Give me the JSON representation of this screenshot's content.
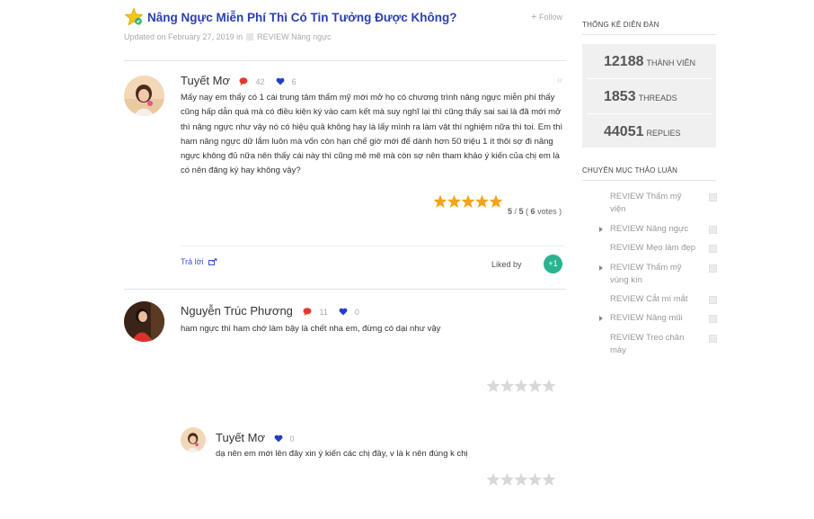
{
  "post": {
    "title": "Nâng Ngực Miễn Phí Thì Có Tin Tưởng Được Không?",
    "updated": "Updated on February 27, 2019 in",
    "category": "REVIEW Nâng ngực",
    "follow_label": "Follow"
  },
  "comments": [
    {
      "author": "Tuyết Mơ",
      "comment_count": "42",
      "like_count": "6",
      "text": "Mấy nay em thấy có 1 cái trung tâm thẩm mỹ mới mở họ có chương trình nâng ngực miễn phí thấy cũng hấp dẫn quá mà có điều kiện ký vào cam kết mà suy nghĩ lại thì cũng thấy sai sai là đã mới mở thì nâng ngực như vậy nó có hiệu quả không hay là lấy mình ra làm vật thí nghiệm nữa thì toi. Em thì ham nâng ngực dữ lắm luôn mà vốn còn hạn chế giờ mới để dành hơn 50 triệu 1 ít thôi sợ đi nâng ngực không đủ nữa nên thấy cái này thì cũng mê mê mà còn sợ nên tham khảo ý kiến của chị em là có nên đăng ký hay không vậy?",
      "rating_score": "5",
      "rating_max": "5",
      "rating_votes": "6",
      "rating_value": 5,
      "votes_word": "votes",
      "reply_label": "Trả lời",
      "liked_by_label": "Liked by",
      "plus_label": "+1"
    },
    {
      "author": "Nguyễn Trúc Phương",
      "comment_count": "11",
      "like_count": "0",
      "text": "ham ngực thì ham chớ làm bậy là chết nha em, đừng có dại như vậy",
      "rating_value": 0
    },
    {
      "author": "Tuyết Mơ",
      "like_count": "0",
      "text": "dạ nên em mới lên đây xin ý kiến các chị đây, v là k nên đúng k chị",
      "rating_value": 0
    }
  ],
  "sidebar": {
    "stats_heading": "THỐNG KÊ DIỄN ĐÀN",
    "stats": [
      {
        "value": "12188",
        "label": "THÀNH VIÊN"
      },
      {
        "value": "1853",
        "label": "THREADS"
      },
      {
        "value": "44051",
        "label": "REPLIES"
      }
    ],
    "categories_heading": "CHUYÊN MỤC THẢO LUẬN",
    "categories": [
      {
        "label": "REVIEW Thẩm mỹ viện",
        "expandable": false
      },
      {
        "label": "REVIEW Nâng ngực",
        "expandable": true
      },
      {
        "label": "REVIEW Mẹo làm đẹp",
        "expandable": false
      },
      {
        "label": "REVIEW Thẩm mỹ vùng kín",
        "expandable": true
      },
      {
        "label": "REVIEW Cắt mí mắt",
        "expandable": false
      },
      {
        "label": "REVIEW Nâng mũi",
        "expandable": true
      },
      {
        "label": "REVIEW Treo chân mày",
        "expandable": false
      }
    ]
  },
  "colors": {
    "title": "#2a3fb1",
    "star_rating": "#f2a51a",
    "star_empty": "#d8d8d8",
    "comment_icon": "#e23b2e",
    "heart_icon": "#2140c9",
    "plus_badge": "#29b38f",
    "stats_bg": "#f0f0f0"
  },
  "icons": [
    "star-badge-icon",
    "plus-icon",
    "folder-icon",
    "comment-icon",
    "heart-icon",
    "quote-icon",
    "star-icon",
    "share-icon",
    "chevron-right-icon"
  ]
}
